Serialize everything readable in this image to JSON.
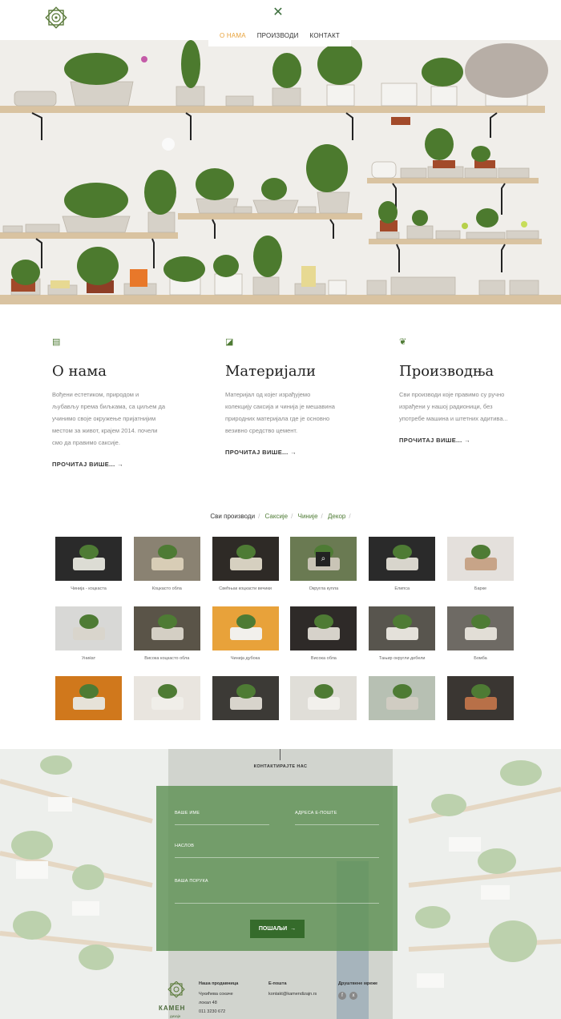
{
  "nav": {
    "items": [
      {
        "label": "О НАМА",
        "active": true
      },
      {
        "label": "ПРОИЗВОДИ",
        "active": false
      },
      {
        "label": "КОНТАКТ",
        "active": false
      }
    ],
    "close_icon": "close-icon",
    "accent": "#e8a23a"
  },
  "features": [
    {
      "icon": "document-icon",
      "title": "О нама",
      "text": [
        "Вођени естетиком, природом и",
        "љубављу према биљкама, са циљем да",
        "учинимо своје окружење пријатнијим",
        "местом за живот, крајем 2014. почели",
        "смо да правимо саксије."
      ],
      "more": "ПРОЧИТАЈ ВИШЕ..."
    },
    {
      "icon": "edit-icon",
      "title": "Материјали",
      "text": [
        "Материјал од којег израђујемо",
        "колекцију саксија и чинија је мешавина",
        "природних материјала где је основно",
        "везивно средство цемент."
      ],
      "more": "ПРОЧИТАЈ ВИШЕ..."
    },
    {
      "icon": "leaf-icon",
      "title": "Производња",
      "text": [
        "Сви производи које правимо су ручно",
        "израђени у нашој радионици, без",
        "употребе машина и штетних адитива..."
      ],
      "more": "ПРОЧИТАЈ ВИШЕ..."
    }
  ],
  "filters": [
    "Сви производи",
    "Саксије",
    "Чиније",
    "Декор"
  ],
  "products": [
    {
      "caption": "Чинија - коцкаста"
    },
    {
      "caption": "Коцкасто обла"
    },
    {
      "caption": "Свећњак коцкасти вечики"
    },
    {
      "caption": "Округла купла"
    },
    {
      "caption": "Елипса"
    },
    {
      "caption": "Барке"
    },
    {
      "caption": "Униќат"
    },
    {
      "caption": "Висока коцкасто обла"
    },
    {
      "caption": "Чинија дубока"
    },
    {
      "caption": "Висока обла"
    },
    {
      "caption": "Тањир округли дебели"
    },
    {
      "caption": "Бомба"
    },
    {
      "caption": ""
    },
    {
      "caption": ""
    },
    {
      "caption": ""
    },
    {
      "caption": ""
    },
    {
      "caption": ""
    },
    {
      "caption": ""
    }
  ],
  "contact": {
    "title": "КОНТАКТИРАЈТЕ НАС",
    "name_label": "ВАШЕ ИМЕ",
    "email_label": "АДРЕСА Е-ПОШТЕ",
    "subject_label": "НАСЛОВ",
    "message_label": "ВАША ПОРУКА",
    "submit": "ПОШАЉИ"
  },
  "footer": {
    "brand": "КАМЕН",
    "brand_sub": "дизајн",
    "shop_heading": "Наша продавница",
    "shop_lines": [
      "Чукићева сокаче",
      "локал 48",
      "011 3230 672"
    ],
    "email_heading": "Е-пошта",
    "email": "kontakt@kamendizajn.rs",
    "social_heading": "Друштвене мреже",
    "social": [
      "f",
      "x"
    ]
  }
}
